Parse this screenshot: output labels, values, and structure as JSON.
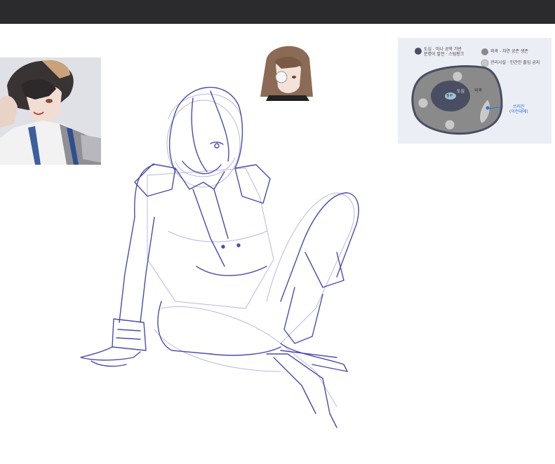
{
  "canvas": {
    "background": "#ffffff",
    "topbar_color": "#2b2b2d"
  },
  "references": [
    {
      "name": "character-portrait-reference",
      "kind": "image"
    },
    {
      "name": "girl-head-reference",
      "kind": "image"
    },
    {
      "name": "city-map-reference",
      "kind": "image"
    }
  ],
  "map_legend": {
    "item1_line1": "도심 - 마나 공학 기반",
    "item1_line2": "문명이 발전 · 스팀펑크",
    "item2": "외곽 - 자연 공존 생존",
    "item3": "관리시설 · 인간인 출입 금지",
    "center_label": "도심",
    "center_badge": "정부",
    "outer_label": "외곽",
    "pointer_line1": "쓰러진",
    "pointer_line2": "(이런데에)"
  },
  "colors": {
    "map_bg": "#eceef6",
    "map_dark": "#4a4e63",
    "map_grey": "#8a8a8a",
    "map_accent": "#2f6fd0",
    "sketch_stroke": "#4a4ab0",
    "sketch_light": "#b8b8de"
  }
}
